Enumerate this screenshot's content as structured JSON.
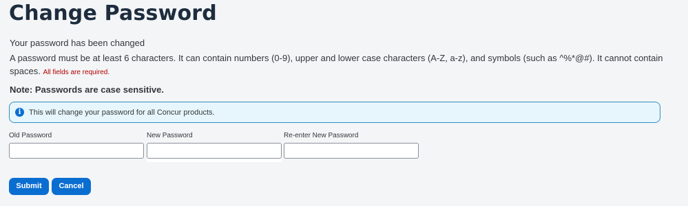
{
  "page": {
    "title": "Change Password",
    "status_message": "Your password has been changed",
    "rules_text": "A password must be at least 6 characters. It can contain numbers (0-9), upper and lower case characters (A-Z, a-z), and symbols (such as ^%*@#). It cannot contain spaces.",
    "required_note": "All fields are required.",
    "case_note": "Note: Passwords are case sensitive."
  },
  "info": {
    "icon": "info-icon",
    "text": "This will change your password for all Concur products."
  },
  "form": {
    "old_password": {
      "label": "Old Password",
      "value": ""
    },
    "new_password": {
      "label": "New Password",
      "value": ""
    },
    "reenter_password": {
      "label": "Re-enter New Password",
      "value": ""
    }
  },
  "actions": {
    "submit_label": "Submit",
    "cancel_label": "Cancel"
  },
  "colors": {
    "accent": "#0a6ed1",
    "info_background": "#e7f6fc",
    "info_border": "#2f8fbf",
    "required_text": "#b00000",
    "title_text": "#1d2d3e"
  }
}
